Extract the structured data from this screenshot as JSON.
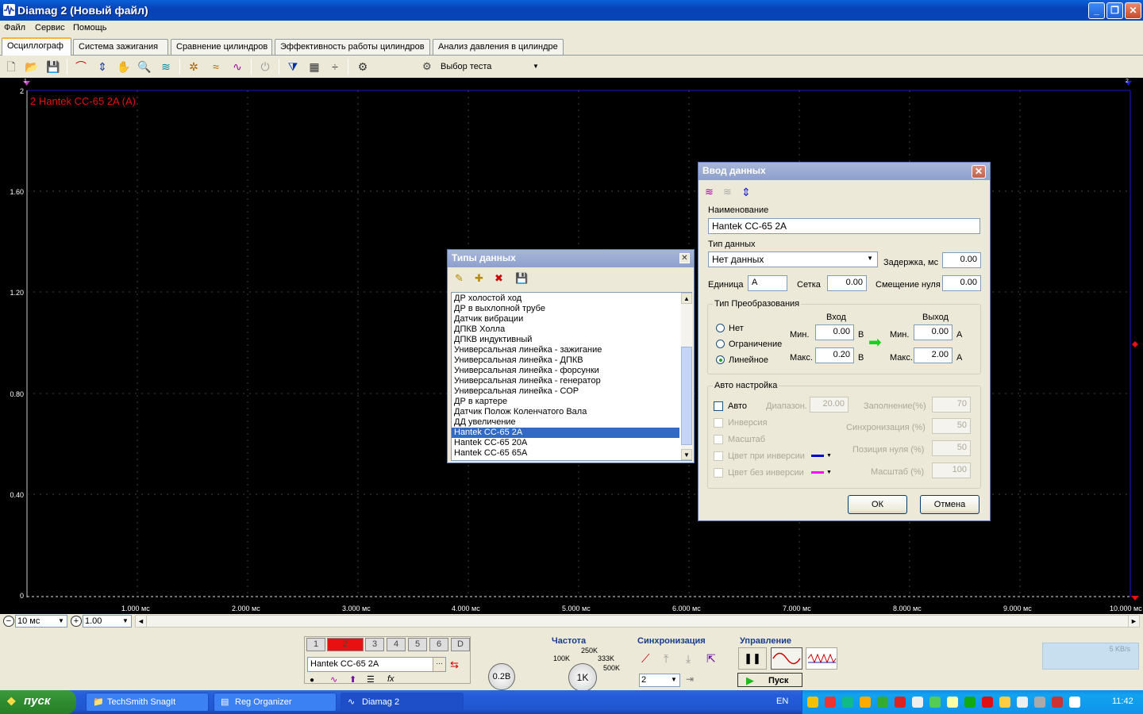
{
  "window": {
    "title": "Diamag 2 (Новый файл)",
    "min": "_",
    "max": "❐",
    "close": "✕"
  },
  "menu": {
    "items": [
      "Файл",
      "Сервис",
      "Помощь"
    ]
  },
  "tabs": [
    "Осциллограф",
    "Система зажигания",
    "Сравнение цилиндров",
    "Эффективность работы цилиндров",
    "Анализ давления в цилиндре"
  ],
  "toolbar": {
    "test_select": "Выбор теста"
  },
  "scope": {
    "channel_label": "2 Hantek CC-65 2A (A)",
    "ch1_marker": "1",
    "ch2_marker": "2",
    "y_ticks": [
      "2",
      "1.60",
      "1.20",
      "0.80",
      "0.40",
      "0"
    ],
    "x_ticks": [
      "1.000 мс",
      "2.000 мс",
      "3.000 мс",
      "4.000 мс",
      "5.000 мс",
      "6.000 мс",
      "7.000 мс",
      "8.000 мс",
      "9.000 мс",
      "10.000 мс"
    ]
  },
  "timebase": {
    "value": "10 мс",
    "scale": "1.00"
  },
  "bottom": {
    "channels": [
      "1",
      "2",
      "3",
      "4",
      "5",
      "6",
      "D"
    ],
    "channel_name": "Hantek CC-65 2A",
    "volts_knob": "0.2В",
    "freq_title": "Частота",
    "freq_marks": [
      "250K",
      "100K",
      "333K",
      "500K"
    ],
    "freq_value": "1K",
    "sync_title": "Синхронизация",
    "sync_channel": "2",
    "control_title": "Управление",
    "start_label": "Пуск",
    "net_rate": "5 KB/s"
  },
  "types_dialog": {
    "title": "Типы данных",
    "items": [
      "ДР холостой ход",
      "ДР в выхлопной трубе",
      "Датчик вибрации",
      "ДПКВ Холла",
      "ДПКВ индуктивный",
      "Универсальная линейка - зажигание",
      "Универсальная линейка - ДПКВ",
      "Универсальная линейка - форсунки",
      "Универсальная линейка - генератор",
      "Универсальная линейка - СОР",
      "ДР в картере",
      "Датчик Полож Коленчатого Вала",
      "ДД увеличение",
      "Hantek CC-65 2A",
      "Hantek CC-65 20A",
      "Hantek CC-65 65A"
    ],
    "selected_index": 13
  },
  "input_dialog": {
    "title": "Ввод данных",
    "name_label": "Наименование",
    "name_value": "Hantek CC-65 2A",
    "type_label": "Тип данных",
    "type_value": "Нет данных",
    "delay_label": "Задержка, мс",
    "delay_value": "0.00",
    "unit_label": "Единица",
    "unit_value": "A",
    "grid_label": "Сетка",
    "grid_value": "0.00",
    "zero_label": "Смещение нуля",
    "zero_value": "0.00",
    "conv": {
      "title": "Тип Преобразования",
      "in_label": "Вход",
      "out_label": "Выход",
      "options": [
        "Нет",
        "Ограничение",
        "Линейное"
      ],
      "selected": "Линейное",
      "min_label": "Мин.",
      "max_label": "Макс.",
      "in_min": "0.00",
      "in_max": "0.20",
      "in_unit": "В",
      "out_min": "0.00",
      "out_max": "2.00",
      "out_unit": "А"
    },
    "auto": {
      "title": "Авто настройка",
      "auto_label": "Авто",
      "range_label": "Диапазон.",
      "range_value": "20.00",
      "fill_label": "Заполнение(%)",
      "fill_value": "70",
      "inv_label": "Инверсия",
      "sync_label": "Синхронизация (%)",
      "sync_value": "50",
      "scale_label": "Масштаб",
      "zero_pos_label": "Позиция нуля (%)",
      "zero_pos_value": "50",
      "inv_color_label": "Цвет при инверсии",
      "noinv_color_label": "Цвет без инверсии",
      "scale_pct_label": "Масштаб (%)",
      "scale_pct_value": "100",
      "inv_color": "#0000cc",
      "noinv_color": "#ff00ff"
    },
    "ok": "ОК",
    "cancel": "Отмена"
  },
  "taskbar": {
    "start": "пуск",
    "tasks": [
      "TechSmith SnagIt",
      "Reg Organizer",
      "Diamag 2"
    ],
    "lang": "EN",
    "clock": "11:42"
  }
}
